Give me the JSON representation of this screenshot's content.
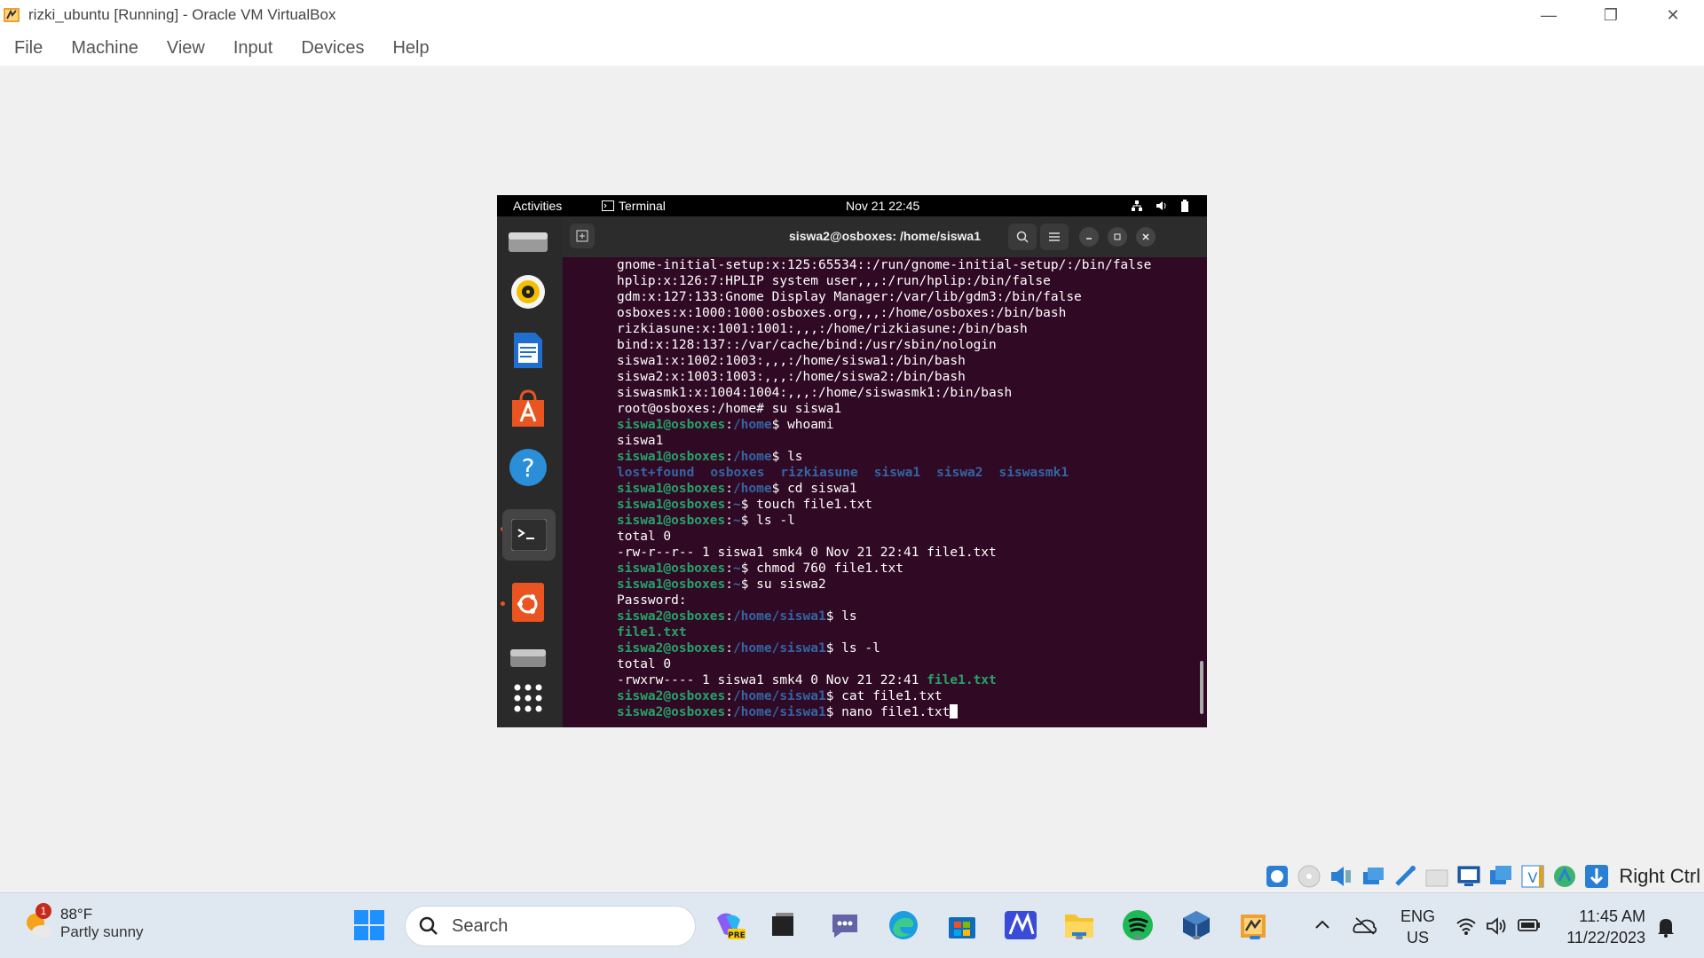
{
  "window": {
    "title": "rizki_ubuntu [Running] - Oracle VM VirtualBox",
    "minimize": "—",
    "restore": "❐",
    "close": "✕"
  },
  "menubar": [
    "File",
    "Machine",
    "View",
    "Input",
    "Devices",
    "Help"
  ],
  "guest": {
    "topbar": {
      "activities": "Activities",
      "app": "Terminal",
      "clock": "Nov 21  22:45"
    },
    "terminal": {
      "title": "siswa2@osboxes: /home/siswa1",
      "lines": [
        {
          "text": "gnome-initial-setup:x:125:65534::/run/gnome-initial-setup/:/bin/false"
        },
        {
          "text": "hplip:x:126:7:HPLIP system user,,,:/run/hplip:/bin/false"
        },
        {
          "text": "gdm:x:127:133:Gnome Display Manager:/var/lib/gdm3:/bin/false"
        },
        {
          "text": "osboxes:x:1000:1000:osboxes.org,,,:/home/osboxes:/bin/bash"
        },
        {
          "text": "rizkiasune:x:1001:1001:,,,:/home/rizkiasune:/bin/bash"
        },
        {
          "text": "bind:x:128:137::/var/cache/bind:/usr/sbin/nologin"
        },
        {
          "text": "siswa1:x:1002:1003:,,,:/home/siswa1:/bin/bash"
        },
        {
          "text": "siswa2:x:1003:1003:,,,:/home/siswa2:/bin/bash"
        },
        {
          "text": "siswasmk1:x:1004:1004:,,,:/home/siswasmk1:/bin/bash"
        },
        {
          "text": "root@osboxes:/home# su siswa1"
        },
        {
          "user": "siswa1@osboxes",
          "path": "/home",
          "cmd": "$ whoami"
        },
        {
          "text": "siswa1"
        },
        {
          "user": "siswa1@osboxes",
          "path": "/home",
          "cmd": "$ ls"
        },
        {
          "dirs": [
            "lost+found",
            "osboxes",
            "rizkiasune",
            "siswa1",
            "siswa2",
            "siswasmk1"
          ]
        },
        {
          "user": "siswa1@osboxes",
          "path": "/home",
          "cmd": "$ cd siswa1"
        },
        {
          "user": "siswa1@osboxes",
          "path": "~",
          "cmd": "$ touch file1.txt"
        },
        {
          "user": "siswa1@osboxes",
          "path": "~",
          "cmd": "$ ls -l"
        },
        {
          "text": "total 0"
        },
        {
          "text": "-rw-r--r-- 1 siswa1 smk4 0 Nov 21 22:41 file1.txt"
        },
        {
          "user": "siswa1@osboxes",
          "path": "~",
          "cmd": "$ chmod 760 file1.txt"
        },
        {
          "user": "siswa1@osboxes",
          "path": "~",
          "cmd": "$ su siswa2"
        },
        {
          "text": "Password:"
        },
        {
          "user": "siswa2@osboxes",
          "path": "/home/siswa1",
          "cmd": "$ ls"
        },
        {
          "file": "file1.txt"
        },
        {
          "user": "siswa2@osboxes",
          "path": "/home/siswa1",
          "cmd": "$ ls -l"
        },
        {
          "text": "total 0"
        },
        {
          "text": "-rwxrw---- 1 siswa1 smk4 0 Nov 21 22:41 ",
          "file": "file1.txt"
        },
        {
          "user": "siswa2@osboxes",
          "path": "/home/siswa1",
          "cmd": "$ cat file1.txt"
        },
        {
          "user": "siswa2@osboxes",
          "path": "/home/siswa1",
          "cmd": "$ nano file1.txt",
          "cursor": true
        }
      ]
    }
  },
  "vbox_status": {
    "host_key": "Right Ctrl"
  },
  "taskbar": {
    "weather": {
      "temp": "88°F",
      "desc": "Partly sunny",
      "badge": "1"
    },
    "search_placeholder": "Search",
    "lang": {
      "line1": "ENG",
      "line2": "US"
    },
    "time": "11:45 AM",
    "date": "11/22/2023"
  },
  "colors": {
    "terminal_bg": "#300a24",
    "prompt_green": "#26a269",
    "path_blue": "#3465a4",
    "ubuntu_orange": "#e95420"
  }
}
